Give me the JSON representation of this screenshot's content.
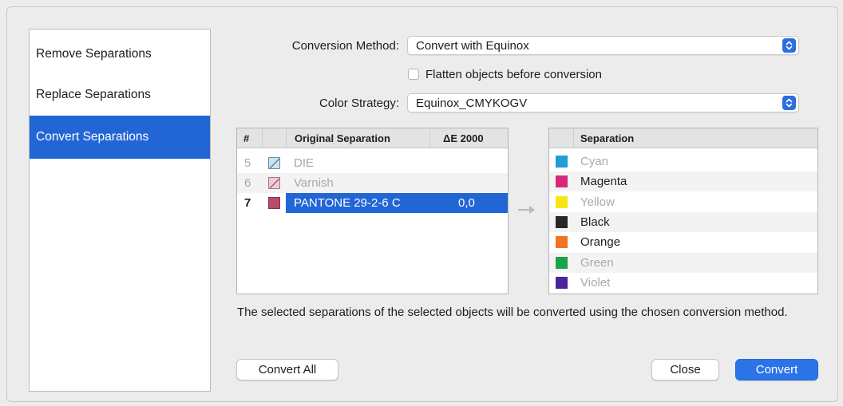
{
  "sidebar": {
    "items": [
      {
        "label": "Remove Separations",
        "selected": false
      },
      {
        "label": "Replace Separations",
        "selected": false
      },
      {
        "label": "Convert Separations",
        "selected": true
      }
    ]
  },
  "form": {
    "conversion_method_label": "Conversion Method:",
    "conversion_method_value": "Convert with Equinox",
    "flatten_label": "Flatten objects before conversion",
    "flatten_checked": false,
    "color_strategy_label": "Color Strategy:",
    "color_strategy_value": "Equinox_CMYKOGV"
  },
  "original_table": {
    "headers": [
      "#",
      "",
      "Original Separation",
      "ΔE 2000"
    ],
    "rows": [
      {
        "num": "5",
        "name": "DIE",
        "de": "",
        "swatch": "#c7e4f2",
        "swatch_type": "diagonal",
        "state": "dim"
      },
      {
        "num": "6",
        "name": "Varnish",
        "de": "",
        "swatch": "#f4c6d9",
        "swatch_type": "diagonal",
        "state": "dim"
      },
      {
        "num": "7",
        "name": "PANTONE 29-2-6 C",
        "de": "0,0",
        "swatch": "#b84a6c",
        "swatch_type": "solid",
        "state": "selected"
      }
    ]
  },
  "separation_table": {
    "header": "Separation",
    "rows": [
      {
        "name": "Cyan",
        "color": "#1d9ed4",
        "dim": true
      },
      {
        "name": "Magenta",
        "color": "#d9287a",
        "dim": false
      },
      {
        "name": "Yellow",
        "color": "#f6e615",
        "dim": true
      },
      {
        "name": "Black",
        "color": "#2a2626",
        "dim": false
      },
      {
        "name": "Orange",
        "color": "#f27322",
        "dim": false
      },
      {
        "name": "Green",
        "color": "#19a34a",
        "dim": true
      },
      {
        "name": "Violet",
        "color": "#4a2699",
        "dim": true
      }
    ]
  },
  "description": "The selected separations of the selected objects will be converted using the chosen conversion method.",
  "buttons": {
    "convert_all": "Convert All",
    "close": "Close",
    "convert": "Convert"
  },
  "icons": {
    "popup_stepper": "up-down-chevron-icon",
    "arrow": "right-arrow-icon"
  },
  "colors": {
    "accent": "#2266d6",
    "selection": "#2266d6"
  }
}
